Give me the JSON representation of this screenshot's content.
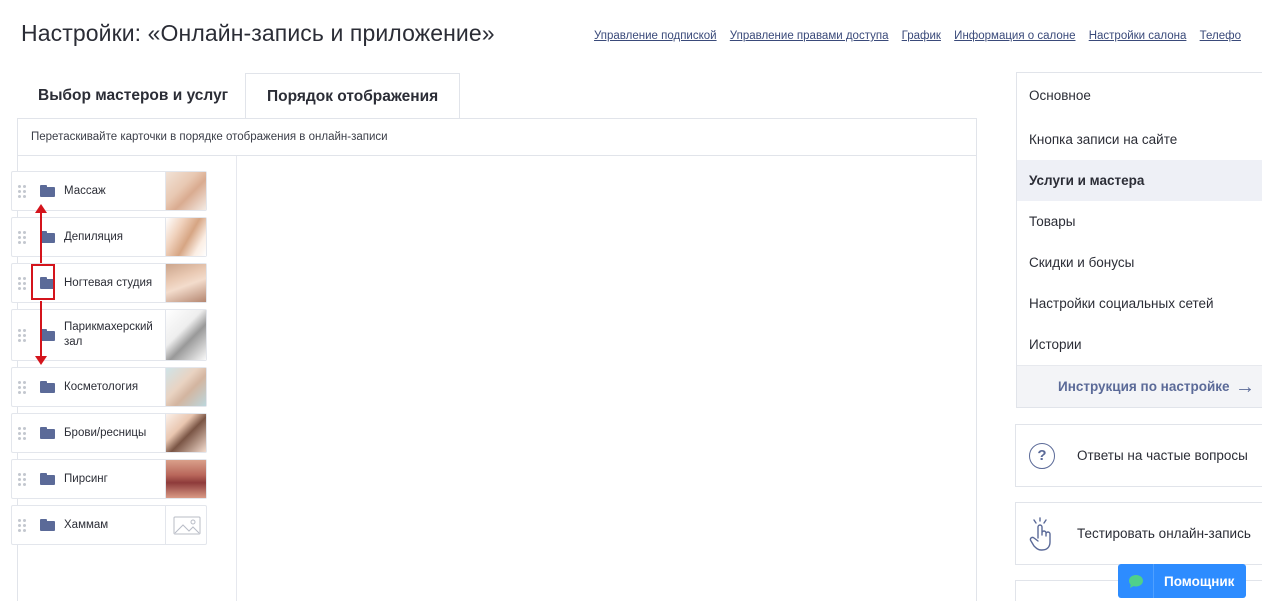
{
  "header": {
    "title": "Настройки: «Онлайн-запись и приложение»",
    "links": [
      "Управление подпиской",
      "Управление правами доступа",
      "График",
      "Информация о салоне",
      "Настройки салона",
      "Телефо"
    ]
  },
  "tabs": {
    "masters": "Выбор мастеров и услуг",
    "order": "Порядок отображения"
  },
  "panel": {
    "hint": "Перетаскивайте карточки в порядке отображения в онлайн-записи",
    "cards": [
      {
        "label": "Массаж",
        "image": "massage-photo"
      },
      {
        "label": "Депиляция",
        "image": "legs-photo"
      },
      {
        "label": "Ногтевая студия",
        "image": "nails-photo"
      },
      {
        "label": "Парикмахерский зал",
        "image": "scissors-photo"
      },
      {
        "label": "Косметология",
        "image": "cosmetology-photo"
      },
      {
        "label": "Брови/ресницы",
        "image": "brows-photo"
      },
      {
        "label": "Пирсинг",
        "image": "piercing-photo"
      },
      {
        "label": "Хаммам",
        "image": "placeholder-image-icon"
      }
    ]
  },
  "side_menu": {
    "items": [
      "Основное",
      "Кнопка записи на сайте",
      "Услуги и мастера",
      "Товары",
      "Скидки и бонусы",
      "Настройки социальных сетей",
      "Истории"
    ],
    "active_index": 2,
    "guide": "Инструкция по настройке"
  },
  "faq": {
    "label": "Ответы на частые вопросы",
    "icon": "question-circle-icon"
  },
  "test": {
    "label": "Тестировать онлайн-запись",
    "icon": "tap-hand-icon"
  },
  "helper": {
    "label": "Помощник",
    "icon": "chat-bubble-icon"
  },
  "colors": {
    "accent": "#5b6a98",
    "helper_blue": "#2d8cff",
    "annotation_red": "#d4141c",
    "active_bg": "#eef0f6"
  }
}
